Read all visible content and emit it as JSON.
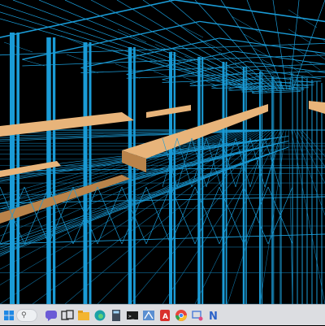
{
  "viewport": {
    "description_colors": {
      "background": "#000000",
      "frame": "#1a9bd6",
      "frame_dark": "#0f6f9e",
      "deck": "#e8b47a",
      "deck_shadow": "#b9834a"
    }
  },
  "taskbar": {
    "background": "#dcdde1",
    "items": [
      {
        "icon": "start-icon"
      },
      {
        "icon": "search-icon"
      },
      {
        "icon": "chat-icon"
      },
      {
        "icon": "task-view-icon"
      },
      {
        "icon": "file-explorer-icon"
      },
      {
        "icon": "edge-browser-icon"
      },
      {
        "icon": "store-icon"
      },
      {
        "icon": "calculator-icon"
      },
      {
        "icon": "terminal-icon"
      },
      {
        "icon": "staad-icon"
      },
      {
        "icon": "acrobat-icon"
      },
      {
        "icon": "chrome-icon"
      },
      {
        "icon": "snipping-icon"
      },
      {
        "icon": "app-n-icon"
      }
    ]
  }
}
